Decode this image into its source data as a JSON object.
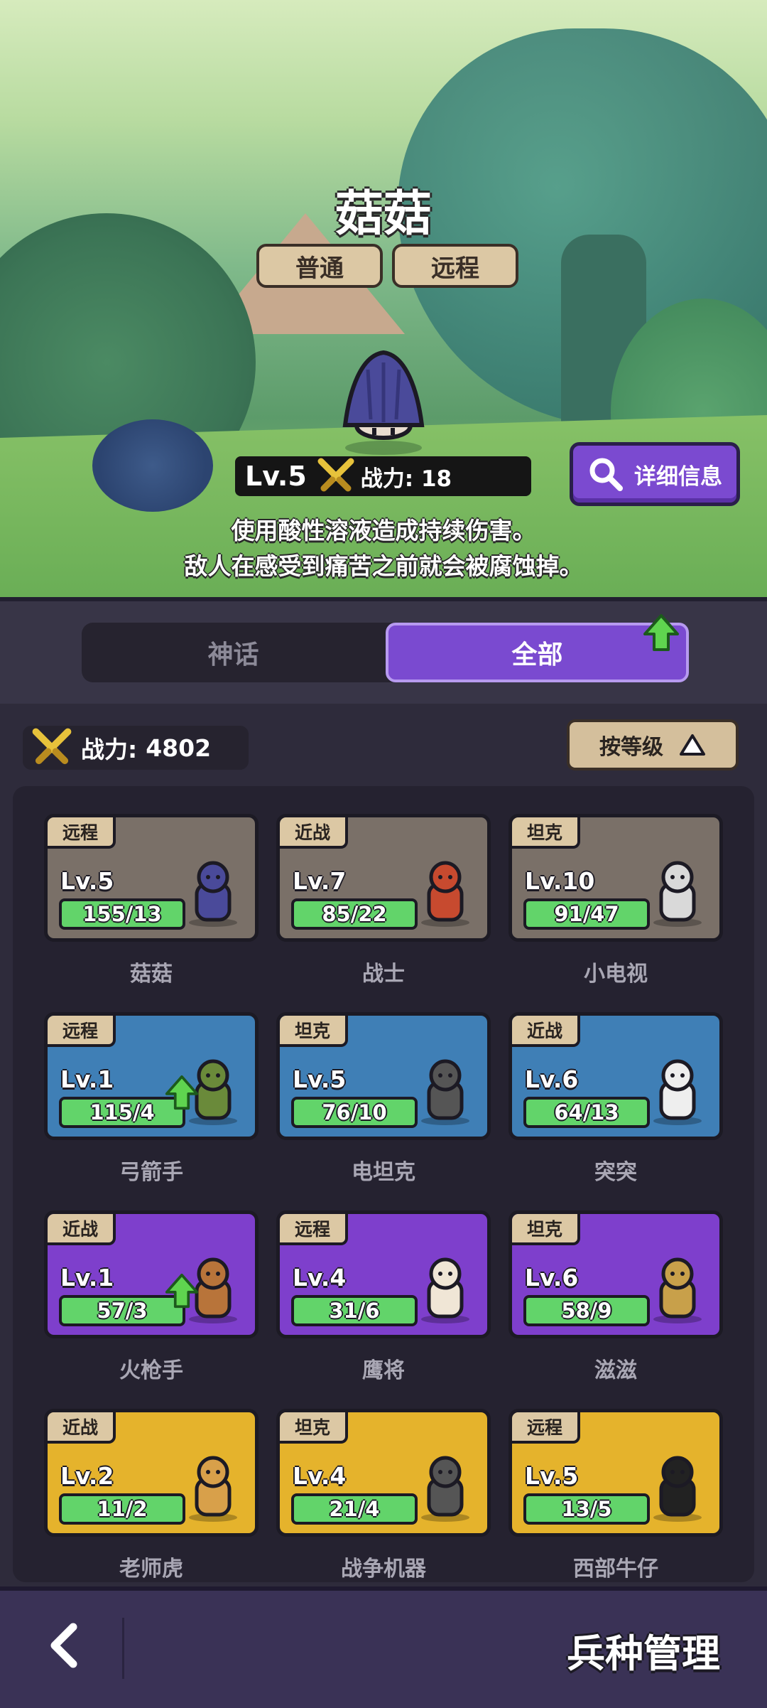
{
  "hero": {
    "unit_name": "菇菇",
    "tags": [
      "普通",
      "远程"
    ],
    "level": "Lv.5",
    "power_label": "战力: 18",
    "detail_button": "详细信息",
    "description_line1": "使用酸性溶液造成持续伤害。",
    "description_line2": "敌人在感受到痛苦之前就会被腐蚀掉。"
  },
  "tabs": {
    "mythic": "神话",
    "all": "全部",
    "selected": "全部"
  },
  "toolbar": {
    "total_power_label": "战力:",
    "total_power_value": "4802",
    "sort_label": "按等级"
  },
  "units": [
    {
      "name": "菇菇",
      "type": "远程",
      "level": "Lv.5",
      "progress": "155/13",
      "rarity": "gray",
      "upgrade": false
    },
    {
      "name": "战士",
      "type": "近战",
      "level": "Lv.7",
      "progress": "85/22",
      "rarity": "gray",
      "upgrade": false
    },
    {
      "name": "小电视",
      "type": "坦克",
      "level": "Lv.10",
      "progress": "91/47",
      "rarity": "gray",
      "upgrade": false
    },
    {
      "name": "弓箭手",
      "type": "远程",
      "level": "Lv.1",
      "progress": "115/4",
      "rarity": "blue",
      "upgrade": true
    },
    {
      "name": "电坦克",
      "type": "坦克",
      "level": "Lv.5",
      "progress": "76/10",
      "rarity": "blue",
      "upgrade": false
    },
    {
      "name": "突突",
      "type": "近战",
      "level": "Lv.6",
      "progress": "64/13",
      "rarity": "blue",
      "upgrade": false
    },
    {
      "name": "火枪手",
      "type": "近战",
      "level": "Lv.1",
      "progress": "57/3",
      "rarity": "purple",
      "upgrade": true
    },
    {
      "name": "鹰将",
      "type": "远程",
      "level": "Lv.4",
      "progress": "31/6",
      "rarity": "purple",
      "upgrade": false
    },
    {
      "name": "滋滋",
      "type": "坦克",
      "level": "Lv.6",
      "progress": "58/9",
      "rarity": "purple",
      "upgrade": false
    },
    {
      "name": "老师虎",
      "type": "近战",
      "level": "Lv.2",
      "progress": "11/2",
      "rarity": "gold",
      "upgrade": false
    },
    {
      "name": "战争机器",
      "type": "坦克",
      "level": "Lv.4",
      "progress": "21/4",
      "rarity": "gold",
      "upgrade": false
    },
    {
      "name": "西部牛仔",
      "type": "远程",
      "level": "Lv.5",
      "progress": "13/5",
      "rarity": "gold",
      "upgrade": false
    }
  ],
  "footer": {
    "title": "兵种管理",
    "back_icon": "chevron-left-icon"
  },
  "colors": {
    "rarity_gray": "#7a7068",
    "rarity_blue": "#3f7fb6",
    "rarity_purple": "#7e3fcc",
    "rarity_gold": "#e5b32c",
    "progress_green": "#62d46a",
    "accent_purple": "#7a4ad0",
    "upgrade_green": "#5fd44f"
  }
}
